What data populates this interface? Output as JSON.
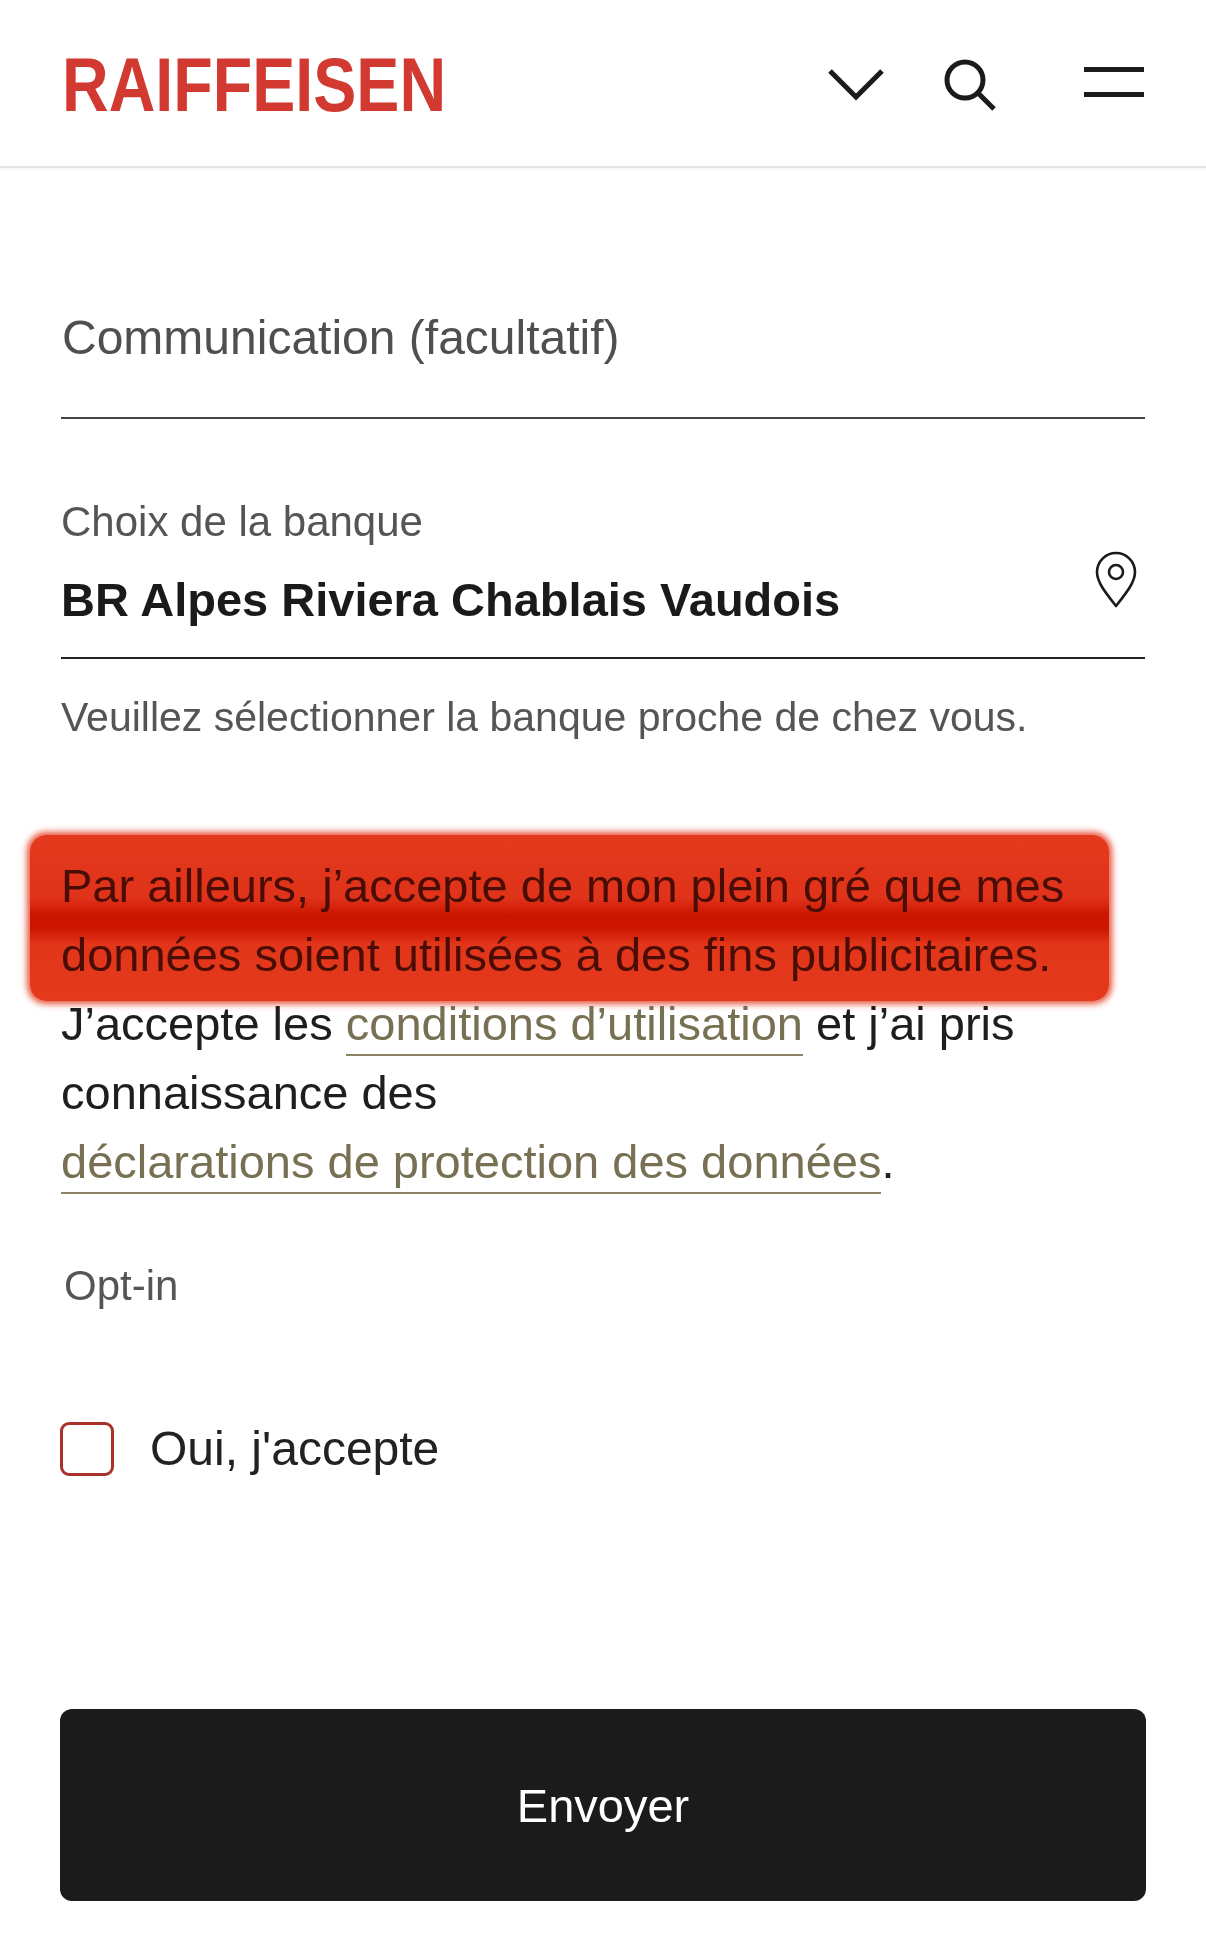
{
  "header": {
    "logo": "RAIFFEISEN"
  },
  "communication": {
    "placeholder": "Communication (facultatif)"
  },
  "bank": {
    "label": "Choix de la banque",
    "value": "BR Alpes Riviera Chablais Vaudois",
    "hint": "Veuillez sélectionner la banque proche de chez vous."
  },
  "consent": {
    "highlighted_sentence": {
      "text": "Par ailleurs, j’accepte de mon plein gré que mes données soient utilisées à des fins publicitaires.",
      "highlighted": true
    },
    "terms_parts": [
      {
        "kind": "text",
        "text": "J’accepte les "
      },
      {
        "kind": "link",
        "text": "conditions d’utilisation"
      },
      {
        "kind": "text",
        "text": " et j’ai pris connaissance des "
      },
      {
        "kind": "link",
        "text": "déclarations de protection des données"
      },
      {
        "kind": "text",
        "text": "."
      }
    ]
  },
  "opt_in": {
    "label": "Opt-in",
    "option": {
      "label": "Oui, j'accepte",
      "checked": false
    }
  },
  "submit": {
    "label": "Envoyer"
  }
}
